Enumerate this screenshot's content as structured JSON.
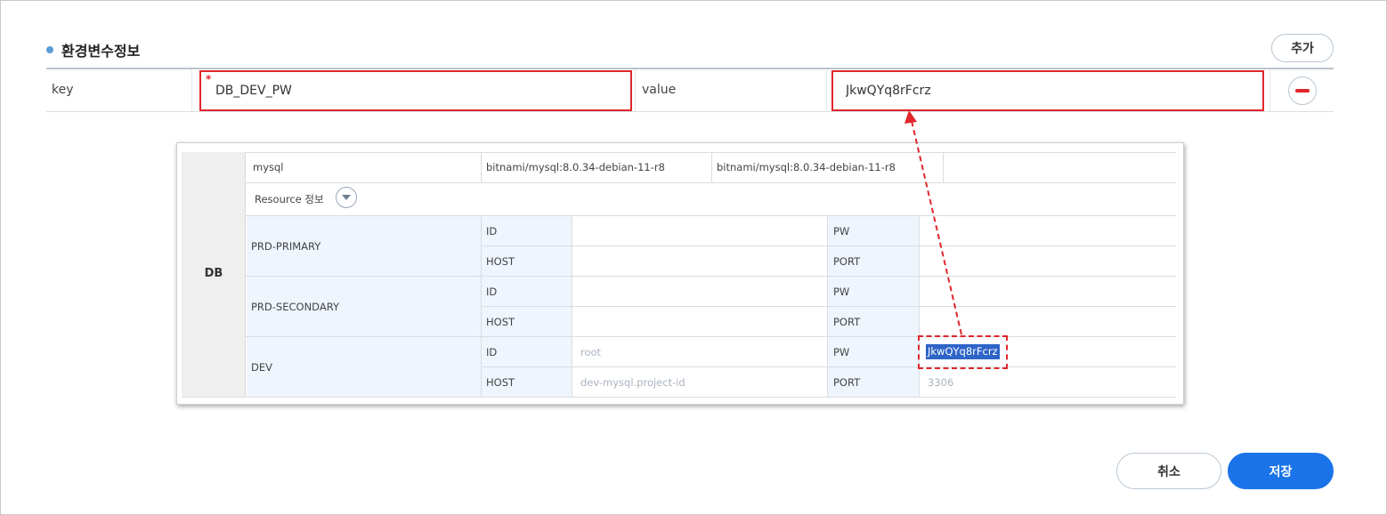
{
  "section": {
    "title": "환경변수정보"
  },
  "toolbar": {
    "add_label": "추가"
  },
  "env_row": {
    "key_label": "key",
    "key_value": "DB_DEV_PW",
    "required_mark": "*",
    "value_label": "value",
    "value_value": "JkwQYq8rFcrz"
  },
  "db_panel": {
    "label": "DB",
    "image_name": "mysql",
    "image_tag_1": "bitnami/mysql:8.0.34-debian-11-r8",
    "image_tag_2": "bitnami/mysql:8.0.34-debian-11-r8",
    "resource_label": "Resource 정보",
    "field_labels": {
      "id": "ID",
      "host": "HOST",
      "pw": "PW",
      "port": "PORT"
    },
    "envs": [
      {
        "name": "PRD-PRIMARY",
        "id": "",
        "host": "",
        "pw": "",
        "port": ""
      },
      {
        "name": "PRD-SECONDARY",
        "id": "",
        "host": "",
        "pw": "",
        "port": ""
      },
      {
        "name": "DEV",
        "id": "root",
        "host": "dev-mysql.project-id",
        "pw": "JkwQYq8rFcrz",
        "port": "3306"
      }
    ]
  },
  "footer": {
    "cancel_label": "취소",
    "save_label": "저장"
  },
  "colors": {
    "accent": "#1a73e8",
    "highlight": "#e0262c",
    "selection": "#2e64c8"
  }
}
